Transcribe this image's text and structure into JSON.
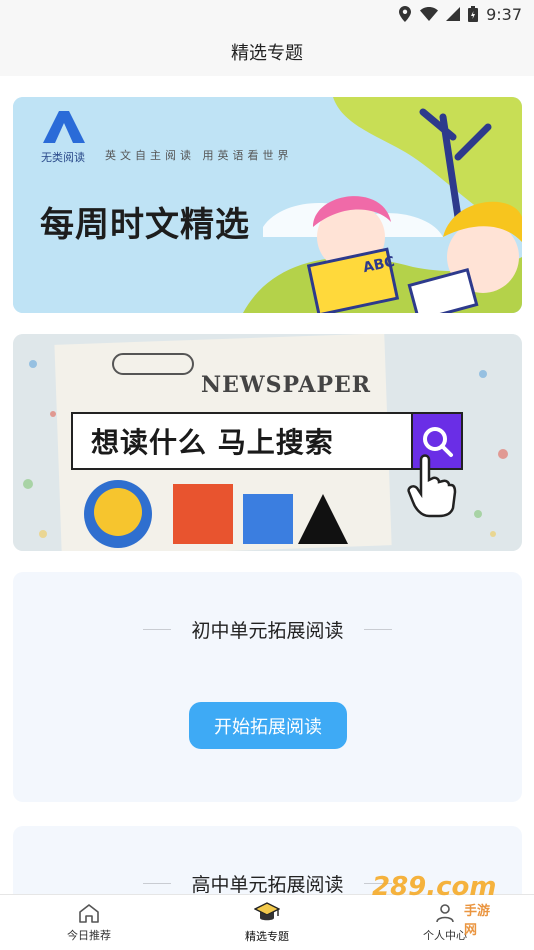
{
  "status_bar": {
    "time": "9:37",
    "icons": [
      "location-icon",
      "wifi-icon",
      "signal-icon",
      "battery-icon"
    ]
  },
  "header": {
    "title": "精选专题"
  },
  "banners": [
    {
      "brand": "无类阅读",
      "slogan": "英文自主阅读  用英语看世界",
      "title": "每周时文精选",
      "badge": "ABC"
    },
    {
      "paper_title": "NEWSPAPER",
      "search_text": "想读什么 马上搜索"
    }
  ],
  "cards": [
    {
      "title": "初中单元拓展阅读",
      "button": "开始拓展阅读"
    },
    {
      "title": "高中单元拓展阅读"
    }
  ],
  "bottom_nav": [
    {
      "label": "今日推荐",
      "icon": "home-icon",
      "active": false
    },
    {
      "label": "精选专题",
      "icon": "graduation-cap-icon",
      "active": true
    },
    {
      "label": "个人中心",
      "icon": "person-icon",
      "active": false
    }
  ],
  "watermark": {
    "text": "289.com",
    "cn": "手游网"
  },
  "colors": {
    "accent": "#3eaaf5",
    "search_btn": "#6a2ee6",
    "card_bg": "#f3f7fd"
  }
}
